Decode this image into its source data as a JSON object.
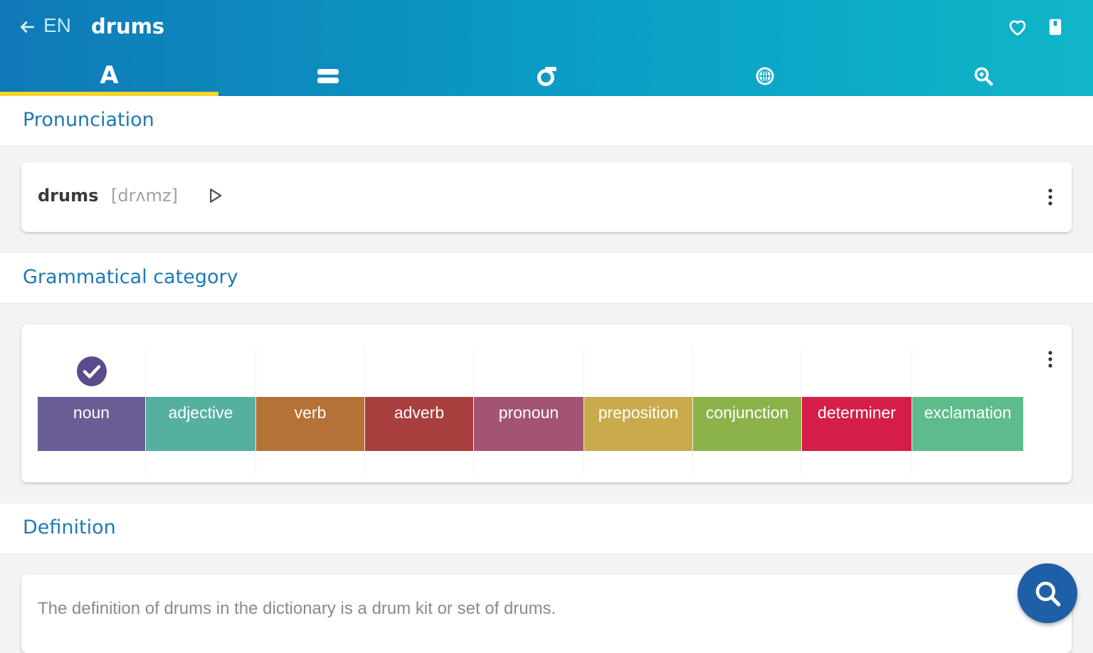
{
  "header": {
    "language": "EN",
    "title": "drums",
    "icons": [
      "back-arrow-icon",
      "heart-icon",
      "bookmark-icon"
    ]
  },
  "tabs": [
    {
      "label": "A",
      "icon": "letter-a-icon",
      "active": true
    },
    {
      "label": "",
      "icon": "lines-icon",
      "active": false
    },
    {
      "label": "",
      "icon": "sigma-icon",
      "active": false
    },
    {
      "label": "",
      "icon": "globe-icon",
      "active": false
    },
    {
      "label": "",
      "icon": "search-icon",
      "active": false
    }
  ],
  "pronunciation": {
    "section_title": "Pronunciation",
    "word": "drums",
    "ipa": "[drʌmz]",
    "icons": [
      "play-icon",
      "more-vert-icon"
    ]
  },
  "grammar": {
    "section_title": "Grammatical category",
    "categories": [
      {
        "label": "noun",
        "color": "#6a5d96",
        "checked": true
      },
      {
        "label": "adjective",
        "color": "#55b09f",
        "checked": false
      },
      {
        "label": "verb",
        "color": "#b47236",
        "checked": false
      },
      {
        "label": "adverb",
        "color": "#a83e3d",
        "checked": false
      },
      {
        "label": "pronoun",
        "color": "#a35473",
        "checked": false
      },
      {
        "label": "preposition",
        "color": "#c9ab4b",
        "checked": false
      },
      {
        "label": "conjunction",
        "color": "#8cb34a",
        "checked": false
      },
      {
        "label": "determiner",
        "color": "#d51e47",
        "checked": false
      },
      {
        "label": "exclamation",
        "color": "#5ebc8c",
        "checked": false
      }
    ]
  },
  "definition": {
    "section_title": "Definition",
    "text": "The definition of drums in the dictionary is a drum kit or set of drums."
  },
  "fab": {
    "icon": "search-icon"
  },
  "colors": {
    "accent": "#1d79b4",
    "tab_indicator": "#f5d52b",
    "fab": "#1f5fa7"
  }
}
